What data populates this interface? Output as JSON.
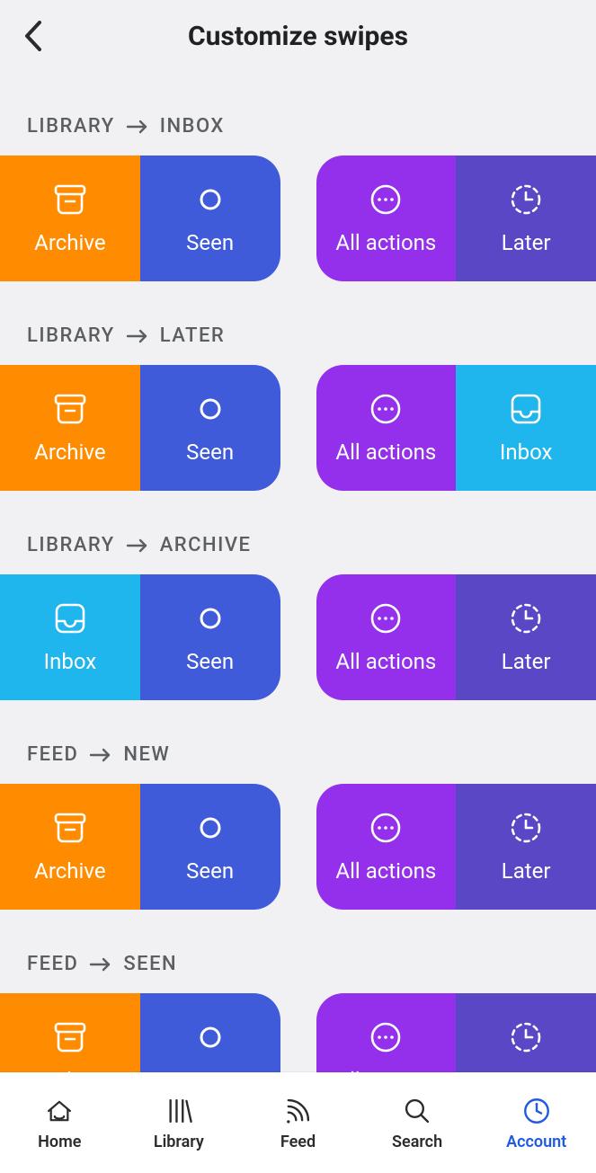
{
  "header": {
    "title": "Customize swipes"
  },
  "sections": [
    {
      "heading_left": "LIBRARY",
      "heading_right": "INBOX",
      "tiles": {
        "l1": {
          "label": "Archive",
          "icon": "archive",
          "color": "orange"
        },
        "l2": {
          "label": "Seen",
          "icon": "circle",
          "color": "blue"
        },
        "r1": {
          "label": "All actions",
          "icon": "all-actions",
          "color": "purple"
        },
        "r2": {
          "label": "Later",
          "icon": "later",
          "color": "dpurple"
        }
      }
    },
    {
      "heading_left": "LIBRARY",
      "heading_right": "LATER",
      "tiles": {
        "l1": {
          "label": "Archive",
          "icon": "archive",
          "color": "orange"
        },
        "l2": {
          "label": "Seen",
          "icon": "circle",
          "color": "blue"
        },
        "r1": {
          "label": "All actions",
          "icon": "all-actions",
          "color": "purple"
        },
        "r2": {
          "label": "Inbox",
          "icon": "inbox",
          "color": "cyan"
        }
      }
    },
    {
      "heading_left": "LIBRARY",
      "heading_right": "ARCHIVE",
      "tiles": {
        "l1": {
          "label": "Inbox",
          "icon": "inbox",
          "color": "cyan"
        },
        "l2": {
          "label": "Seen",
          "icon": "circle",
          "color": "blue"
        },
        "r1": {
          "label": "All actions",
          "icon": "all-actions",
          "color": "purple"
        },
        "r2": {
          "label": "Later",
          "icon": "later",
          "color": "dpurple"
        }
      }
    },
    {
      "heading_left": "FEED",
      "heading_right": "NEW",
      "tiles": {
        "l1": {
          "label": "Archive",
          "icon": "archive",
          "color": "orange"
        },
        "l2": {
          "label": "Seen",
          "icon": "circle",
          "color": "blue"
        },
        "r1": {
          "label": "All actions",
          "icon": "all-actions",
          "color": "purple"
        },
        "r2": {
          "label": "Later",
          "icon": "later",
          "color": "dpurple"
        }
      }
    },
    {
      "heading_left": "FEED",
      "heading_right": "SEEN",
      "tiles": {
        "l1": {
          "label": "Archive",
          "icon": "archive",
          "color": "orange"
        },
        "l2": {
          "label": "Seen",
          "icon": "circle",
          "color": "blue"
        },
        "r1": {
          "label": "All actions",
          "icon": "all-actions",
          "color": "purple"
        },
        "r2": {
          "label": "Later",
          "icon": "later",
          "color": "dpurple"
        }
      }
    }
  ],
  "tabs": [
    {
      "label": "Home",
      "icon": "home",
      "active": false
    },
    {
      "label": "Library",
      "icon": "library",
      "active": false
    },
    {
      "label": "Feed",
      "icon": "feed",
      "active": false
    },
    {
      "label": "Search",
      "icon": "search",
      "active": false
    },
    {
      "label": "Account",
      "icon": "account",
      "active": true
    }
  ],
  "colors": {
    "orange": "#ff8c00",
    "blue": "#3f5bda",
    "purple": "#9430ec",
    "dpurple": "#5947c6",
    "cyan": "#1fb5ed",
    "accent": "#2159e0"
  }
}
